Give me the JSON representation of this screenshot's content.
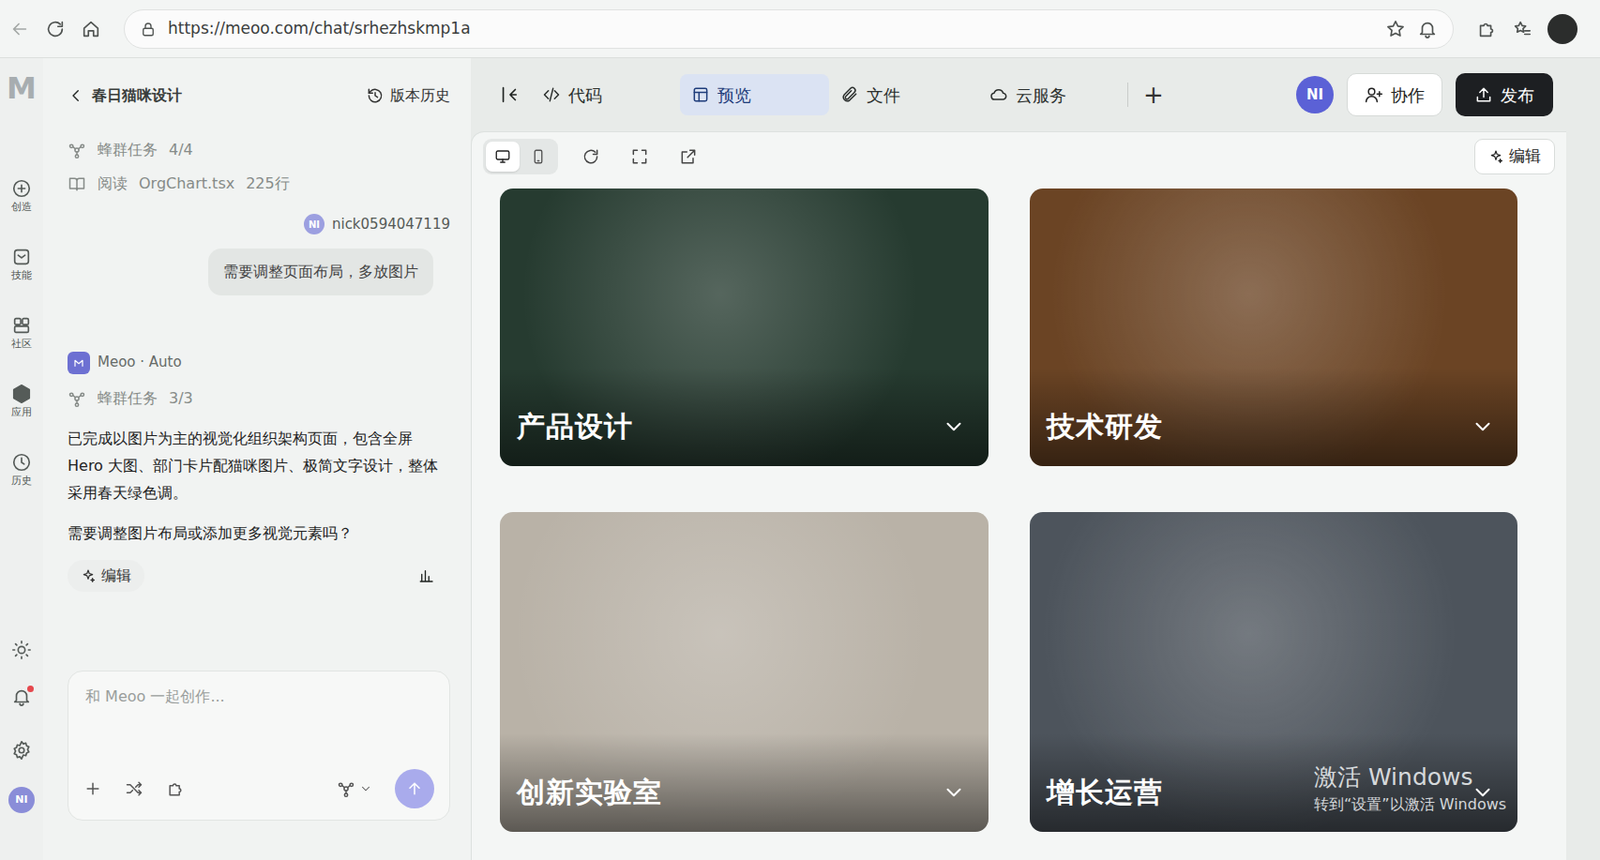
{
  "browser": {
    "url": "https://meoo.com/chat/srhezhskmp1a"
  },
  "rail": {
    "logo": "M",
    "items": [
      {
        "label": "创造",
        "selected": false
      },
      {
        "label": "技能",
        "selected": false
      },
      {
        "label": "社区",
        "selected": false
      },
      {
        "label": "应用",
        "selected": false
      },
      {
        "label": "历史",
        "selected": false
      }
    ],
    "notifications": {
      "unread": true
    },
    "avatar": "NI"
  },
  "chat": {
    "title": "春日猫咪设计",
    "history_button": "版本历史",
    "activity": [
      {
        "kind": "task",
        "label": "蜂群任务",
        "count": "4/4"
      },
      {
        "kind": "read",
        "label": "阅读",
        "file": "OrgChart.tsx",
        "lines": "225行"
      }
    ],
    "user": {
      "avatar": "NI",
      "name": "nick0594047119",
      "message": "需要调整页面布局，多放图片"
    },
    "assistant": {
      "name": "Meoo · Auto",
      "task": {
        "label": "蜂群任务",
        "count": "3/3"
      },
      "paragraphs": [
        "已完成以图片为主的视觉化组织架构页面，包含全屏 Hero 大图、部门卡片配猫咪图片、极简文字设计，整体采用春天绿色调。",
        "需要调整图片布局或添加更多视觉元素吗？"
      ],
      "edit_button": "编辑"
    },
    "composer": {
      "placeholder": "和 Meoo 一起创作..."
    }
  },
  "topbar": {
    "tabs": [
      {
        "label": "代码",
        "selected": false
      },
      {
        "label": "预览",
        "selected": true
      },
      {
        "label": "文件",
        "selected": false
      },
      {
        "label": "云服务",
        "selected": false
      }
    ],
    "add": "+",
    "avatar": "NI",
    "collaborate": "协作",
    "publish": "发布"
  },
  "preview": {
    "devices": [
      {
        "kind": "desktop",
        "selected": true
      },
      {
        "kind": "mobile",
        "selected": false
      }
    ],
    "edit_button": "编辑",
    "cards": [
      {
        "title": "产品设计",
        "expanded": false,
        "color": "#263b30"
      },
      {
        "title": "技术研发",
        "expanded": false,
        "color": "#6b4424"
      },
      {
        "title": "创新实验室",
        "expanded": false,
        "color": "#b9b2a7"
      },
      {
        "title": "增长运营",
        "expanded": false,
        "color": "#4d545c"
      }
    ]
  },
  "watermark": {
    "title": "激活 Windows",
    "subtitle": "转到“设置”以激活 Windows"
  }
}
